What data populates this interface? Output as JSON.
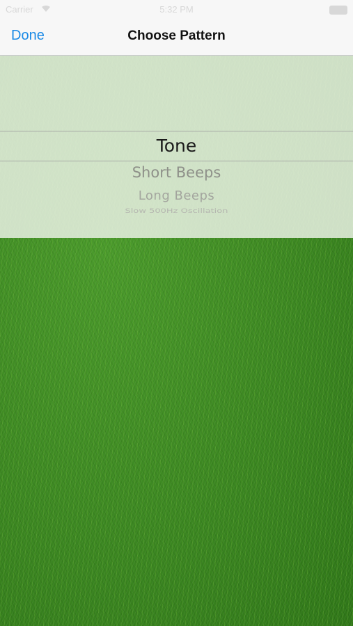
{
  "status_bar": {
    "carrier": "Carrier",
    "time": "5:32 PM"
  },
  "nav": {
    "done_label": "Done",
    "title": "Choose Pattern"
  },
  "picker": {
    "selected": "Tone",
    "items": [
      "Tone",
      "Short Beeps",
      "Long Beeps",
      "Slow 500Hz Oscillation"
    ]
  },
  "colors": {
    "accent": "#1a8ae6",
    "grass": "#3d8a22"
  }
}
